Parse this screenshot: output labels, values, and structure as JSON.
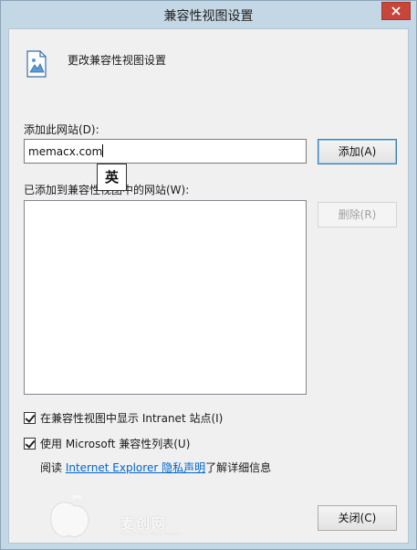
{
  "window": {
    "title": "兼容性视图设置"
  },
  "header": {
    "text": "更改兼容性视图设置"
  },
  "add": {
    "label": "添加此网站(D):",
    "input_value": "memacx.com",
    "button": "添加(A)",
    "ime_indicator": "英"
  },
  "list": {
    "label": "已添加到兼容性视图中的网站(W):",
    "remove_button": "删除(R)",
    "items": []
  },
  "options": {
    "intranet_label": "在兼容性视图中显示 Intranet 站点(I)",
    "intranet_checked": true,
    "mslist_label": "使用 Microsoft 兼容性列表(U)",
    "mslist_checked": true
  },
  "info": {
    "prefix": "阅读 ",
    "link": "Internet Explorer 隐私声明",
    "suffix": "了解详细信息"
  },
  "footer": {
    "close_button": "关闭(C)"
  },
  "watermark": {
    "text": "麦创网",
    "sub": "Your FirTools Made Network"
  },
  "colors": {
    "accent": "#3c7fb1",
    "link": "#0066cc",
    "close": "#c7453a"
  }
}
